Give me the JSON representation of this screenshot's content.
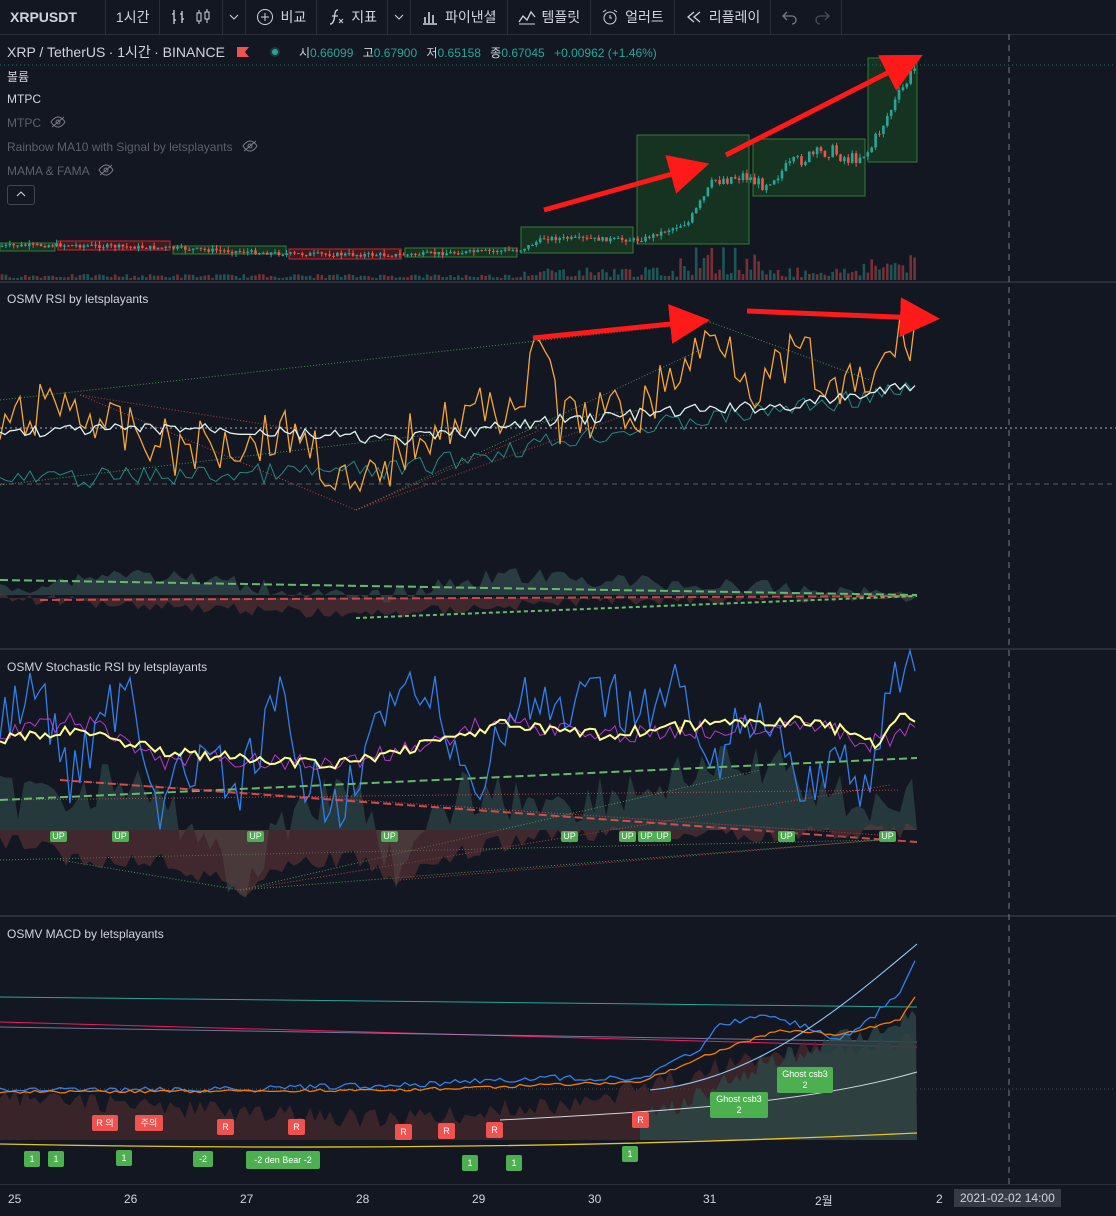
{
  "toolbar": {
    "symbol": "XRPUSDT",
    "interval": "1시간",
    "compare": "비교",
    "indicators": "지표",
    "financials": "파이낸셜",
    "templates": "템플릿",
    "alert": "얼러트",
    "replay": "리플레이"
  },
  "legend": {
    "pair": "XRP / TetherUS",
    "interval": "1시간",
    "exchange": "BINANCE",
    "open_label": "시",
    "open": "0.66099",
    "high_label": "고",
    "high": "0.67900",
    "low_label": "저",
    "low": "0.65158",
    "close_label": "종",
    "close": "0.67045",
    "change": "+0.00962 (+1.46%)"
  },
  "overlays": {
    "volume": "볼륨",
    "mtpc_active": "MTPC",
    "mtpc_hidden": "MTPC",
    "rainbow": "Rainbow MA10 with Signal by letsplayants",
    "mama": "MAMA & FAMA"
  },
  "panes": {
    "rsi": "OSMV RSI by letsplayants",
    "stoch": "OSMV Stochastic RSI by letsplayants",
    "macd": "OSMV MACD by letsplayants"
  },
  "stoch_labels": [
    "UP",
    "UP",
    "UP",
    "UP",
    "UP",
    "UP",
    "UP",
    "UP",
    "UP"
  ],
  "macd_labels": {
    "ghost1": "Ghost csb3",
    "ghost1_n": "2",
    "ghost2": "Ghost csb3",
    "ghost2_n": "2",
    "r_ui": "R 의",
    "caution": "주의",
    "r": "R",
    "one": "1",
    "minus2": "-2",
    "hidden_bear": "-2  den Bear -2"
  },
  "time_axis": {
    "ticks": [
      "25",
      "26",
      "27",
      "28",
      "29",
      "30",
      "31",
      "2월",
      "2"
    ],
    "crosshair": "2021-02-02   14:00"
  },
  "colors": {
    "background": "#131722",
    "up": "#26a69a",
    "down": "#ef5350",
    "annotation_arrow": "#ff1a1a",
    "box_green": "#1b5e20",
    "rsi_orange": "#f7a534",
    "stoch_blue": "#2f80ed"
  }
}
